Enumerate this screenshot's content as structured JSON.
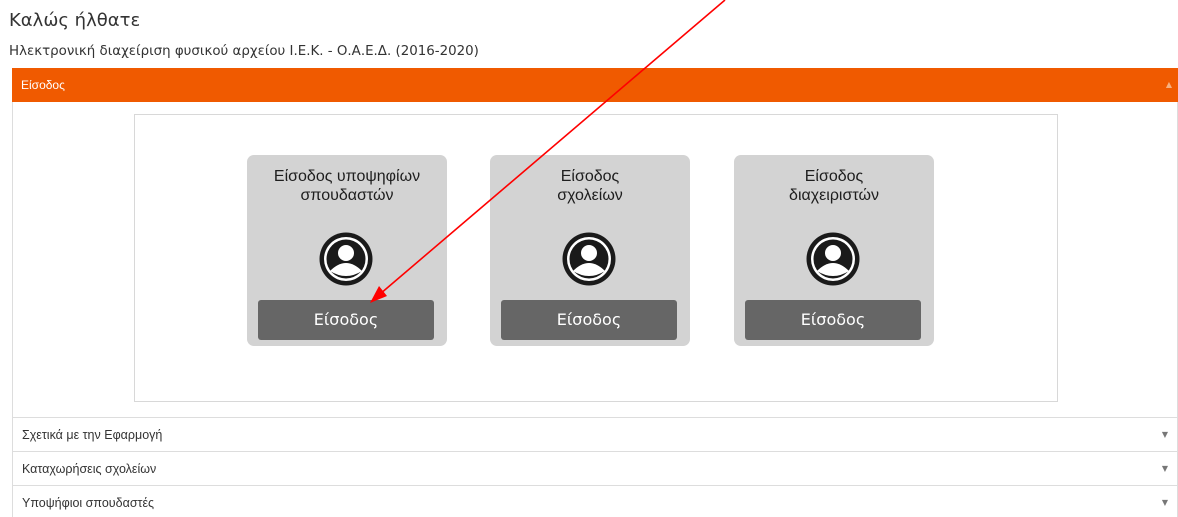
{
  "page": {
    "title": "Καλώς ήλθατε",
    "subtitle": "Ηλεκτρονική διαχείριση φυσικού αρχείου Ι.Ε.Κ. - Ο.Α.Ε.Δ. (2016-2020)"
  },
  "accordion": {
    "active_section": {
      "label": "Είσοδος",
      "arrow_icon": "triangle-up-icon",
      "color": "#f05a00"
    },
    "login_cards": [
      {
        "title": "Είσοδος υποψηφίων σπουδαστών",
        "icon": "user-icon",
        "button_label": "Είσοδος"
      },
      {
        "title": "Είσοδος σχολείων",
        "icon": "user-icon",
        "button_label": "Είσοδος"
      },
      {
        "title": "Είσοδος διαχειριστών",
        "icon": "user-icon",
        "button_label": "Είσοδος"
      }
    ],
    "collapsed_sections": [
      {
        "label": "Σχετικά με την Εφαρμογή",
        "arrow_icon": "triangle-down-icon"
      },
      {
        "label": "Καταχωρήσεις σχολείων",
        "arrow_icon": "triangle-down-icon"
      },
      {
        "label": "Υποψήφιοι σπουδαστές",
        "arrow_icon": "triangle-down-icon"
      }
    ]
  },
  "annotation": {
    "type": "arrow",
    "color": "#ff0000",
    "points_to": "card-0 login button"
  }
}
